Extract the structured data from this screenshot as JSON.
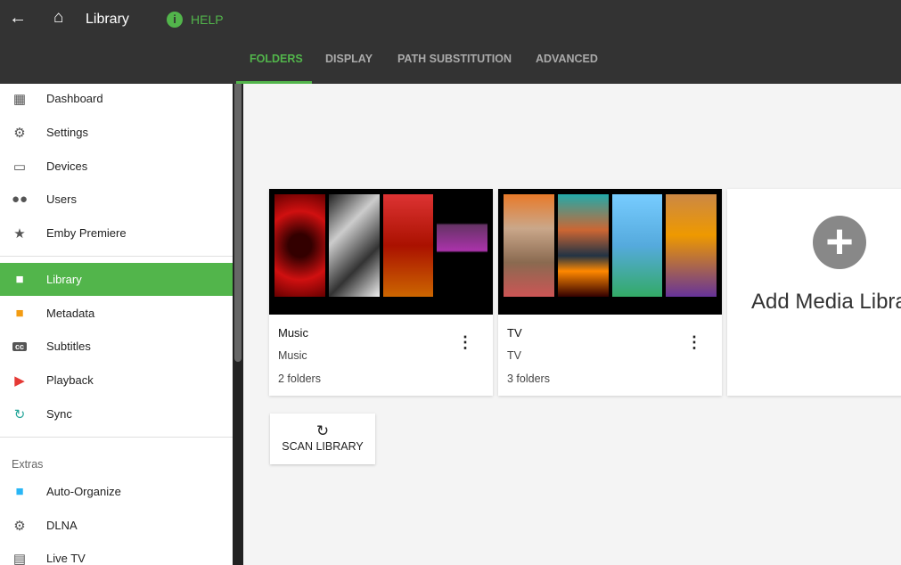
{
  "header": {
    "title": "Library",
    "help": "HELP",
    "tabs": [
      "FOLDERS",
      "DISPLAY",
      "PATH SUBSTITUTION",
      "ADVANCED"
    ]
  },
  "sidebar": {
    "items": [
      {
        "label": "Dashboard",
        "icon": "dashboard-icon"
      },
      {
        "label": "Settings",
        "icon": "gear-icon"
      },
      {
        "label": "Devices",
        "icon": "devices-icon"
      },
      {
        "label": "Users",
        "icon": "users-icon"
      },
      {
        "label": "Emby Premiere",
        "icon": "star-icon"
      },
      {
        "label": "Library",
        "icon": "folder-icon"
      },
      {
        "label": "Metadata",
        "icon": "file-icon"
      },
      {
        "label": "Subtitles",
        "icon": "cc-icon"
      },
      {
        "label": "Playback",
        "icon": "play-icon"
      },
      {
        "label": "Sync",
        "icon": "sync-icon"
      },
      {
        "label": "Auto-Organize",
        "icon": "folder-icon"
      },
      {
        "label": "DLNA",
        "icon": "gear-icon"
      },
      {
        "label": "Live TV",
        "icon": "tv-icon"
      }
    ],
    "section": "Extras"
  },
  "libraries": [
    {
      "title": "Music",
      "type": "Music",
      "count": "2 folders"
    },
    {
      "title": "TV",
      "type": "TV",
      "count": "3 folders"
    }
  ],
  "add_label": "Add Media Library",
  "scan_label": "SCAN LIBRARY",
  "colors": {
    "accent": "#52b54b",
    "header": "#333333"
  }
}
